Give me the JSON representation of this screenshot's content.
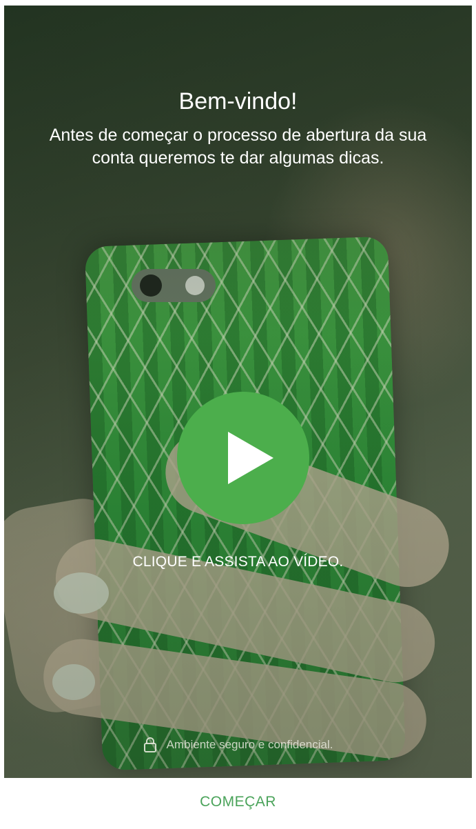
{
  "welcome": {
    "title": "Bem-vindo!",
    "subtitle": "Antes de começar o processo de abertura da sua conta queremos te dar algumas dicas."
  },
  "video": {
    "play_icon": "play-icon",
    "cta_label": "CLIQUE E ASSISTA AO VÍDEO."
  },
  "security": {
    "icon": "lock-icon",
    "label": "Ambiente seguro e confidencial."
  },
  "footer": {
    "start_label": "COMEÇAR"
  },
  "colors": {
    "accent": "#4cae4c",
    "button_text": "#4aa35a"
  }
}
